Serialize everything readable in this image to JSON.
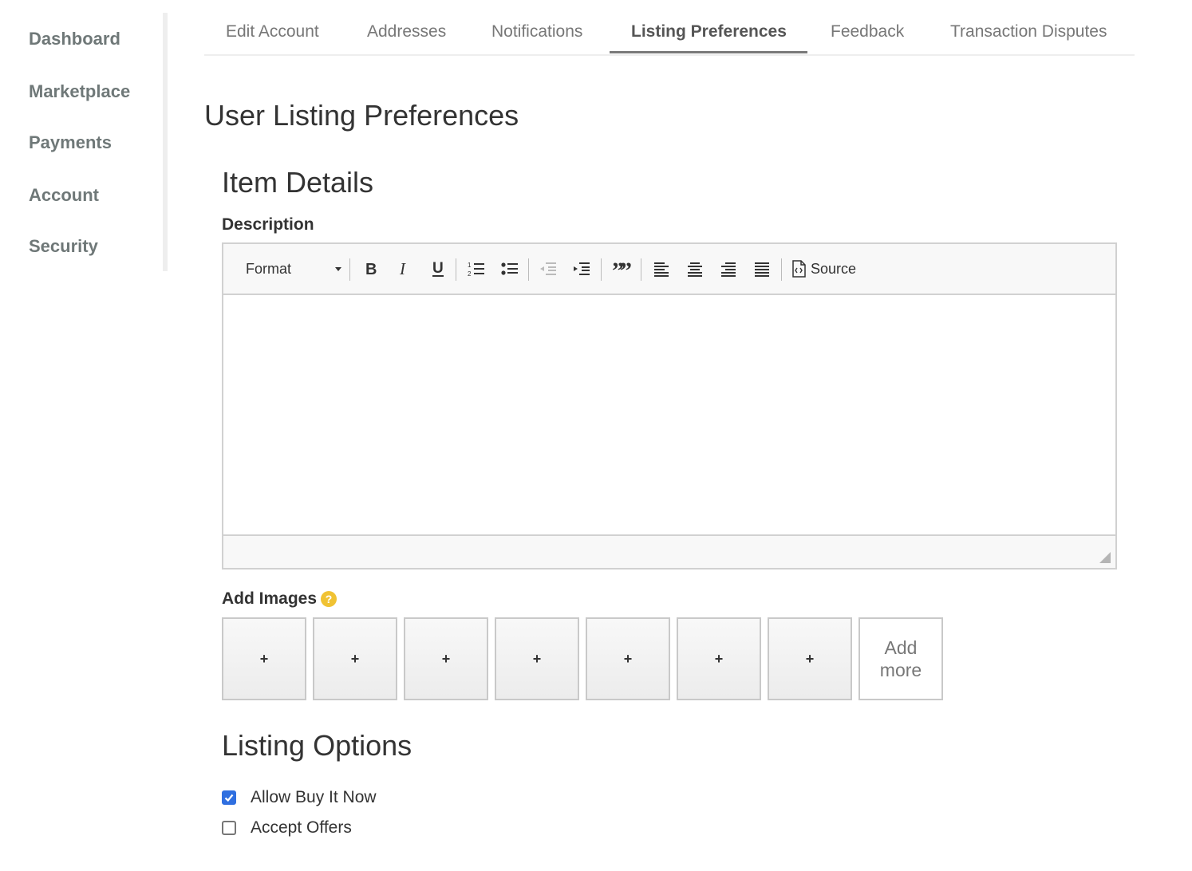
{
  "sidebar": {
    "items": [
      {
        "label": "Dashboard"
      },
      {
        "label": "Marketplace"
      },
      {
        "label": "Payments"
      },
      {
        "label": "Account"
      },
      {
        "label": "Security"
      }
    ]
  },
  "tabs": [
    {
      "label": "Edit Account",
      "active": false
    },
    {
      "label": "Addresses",
      "active": false
    },
    {
      "label": "Notifications",
      "active": false
    },
    {
      "label": "Listing Preferences",
      "active": true
    },
    {
      "label": "Feedback",
      "active": false
    },
    {
      "label": "Transaction Disputes",
      "active": false
    }
  ],
  "page": {
    "title": "User Listing Preferences"
  },
  "item_details": {
    "title": "Item Details",
    "description_label": "Description",
    "editor": {
      "format_label": "Format",
      "source_label": "Source",
      "content": "",
      "toolbar_icons": [
        "bold-icon",
        "italic-icon",
        "underline-icon",
        "numbered-list-icon",
        "bulleted-list-icon",
        "outdent-icon",
        "indent-icon",
        "blockquote-icon",
        "align-left-icon",
        "align-center-icon",
        "align-right-icon",
        "justify-icon",
        "source-icon"
      ]
    },
    "images": {
      "label": "Add Images",
      "help_glyph": "?",
      "help_color": "#f0c233",
      "slot_glyph": "+",
      "slot_count": 7,
      "add_more_line1": "Add",
      "add_more_line2": "more"
    }
  },
  "listing_options": {
    "title": "Listing Options",
    "options": [
      {
        "label": "Allow Buy It Now",
        "checked": true
      },
      {
        "label": "Accept Offers",
        "checked": false
      }
    ],
    "checkbox_color": "#2f6fe0"
  }
}
